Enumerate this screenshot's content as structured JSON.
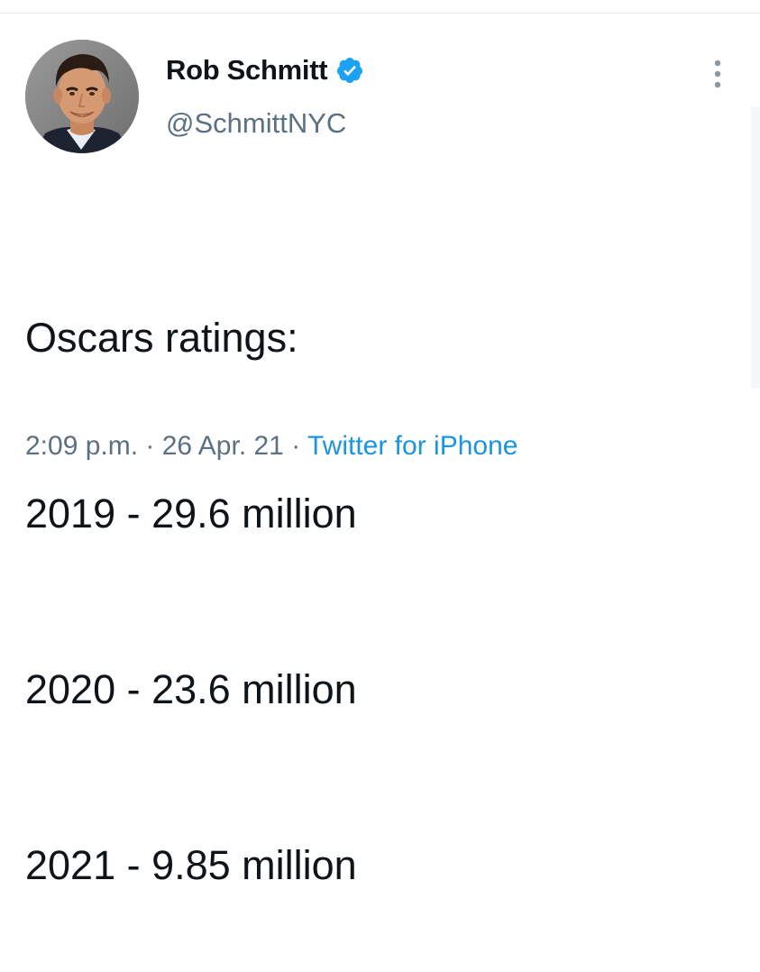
{
  "tweet": {
    "author": {
      "display_name": "Rob Schmitt",
      "handle": "@SchmittNYC",
      "verified_icon": "verified-badge-icon",
      "avatar_icon": "profile-photo"
    },
    "text_lines": [
      "Oscars ratings:",
      "2019 - 29.6 million",
      "2020 - 23.6 million",
      "2021 - 9.85 million"
    ],
    "meta": {
      "time": "2:09 p.m.",
      "separator_1": " · ",
      "date": "26 Apr. 21",
      "separator_2": " · ",
      "source": "Twitter for iPhone"
    },
    "more_icon": "more-options-icon"
  },
  "colors": {
    "text_primary": "#0f1419",
    "text_secondary": "#5b7083",
    "link": "#1b95e0",
    "verified": "#1da1f2"
  }
}
